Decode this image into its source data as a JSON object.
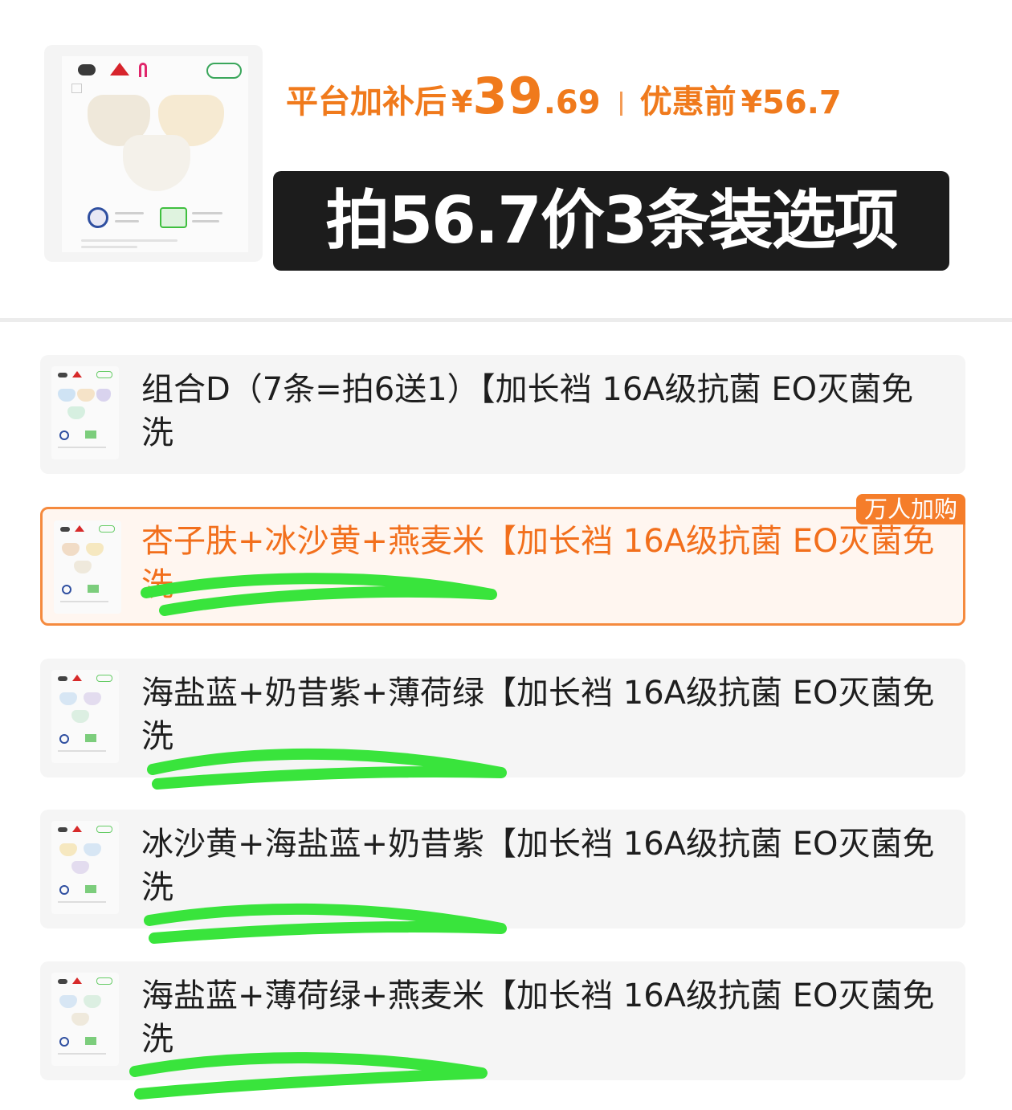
{
  "header": {
    "price_label": "平台加补后",
    "price_currency": "¥",
    "price_integer": "39",
    "price_decimal": ".69",
    "original_label": "优惠前",
    "original_currency": "¥",
    "original_price": "56.7",
    "banner_text": "拍56.7价3条装选项"
  },
  "options": [
    {
      "name": "组合D（7条=拍6送1）",
      "desc": "【加长裆 16A级抗菌 EO灭菌免洗",
      "selected": false,
      "tag": "",
      "colors": [
        "#cfe3f4",
        "#f5e3c8",
        "#d9d3ee",
        "#d6efe0"
      ]
    },
    {
      "name": "杏子肤+冰沙黄+燕麦米",
      "desc": "【加长裆 16A级抗菌 EO灭菌免洗",
      "selected": true,
      "tag": "万人加购",
      "colors": [
        "#f1dcc6",
        "#f6e8c0",
        "#efe9dc"
      ]
    },
    {
      "name": "海盐蓝+奶昔紫+薄荷绿",
      "desc": "【加长裆 16A级抗菌 EO灭菌免洗",
      "selected": false,
      "tag": "",
      "colors": [
        "#d7e6f4",
        "#e3dcef",
        "#dcefe2"
      ]
    },
    {
      "name": "冰沙黄+海盐蓝+奶昔紫",
      "desc": "【加长裆 16A级抗菌 EO灭菌免洗",
      "selected": false,
      "tag": "",
      "colors": [
        "#f6e8c0",
        "#d7e6f4",
        "#e3dcef"
      ]
    },
    {
      "name": "海盐蓝+薄荷绿+燕麦米",
      "desc": "【加长裆 16A级抗菌 EO灭菌免洗",
      "selected": false,
      "tag": "",
      "colors": [
        "#d7e6f4",
        "#dcefe2",
        "#efe9dc"
      ]
    }
  ],
  "colors": {
    "accent": "#f07a1c",
    "selected_border": "#f58a3e",
    "banner_bg": "#1c1c1c",
    "highlight_stroke": "#33e83a"
  }
}
